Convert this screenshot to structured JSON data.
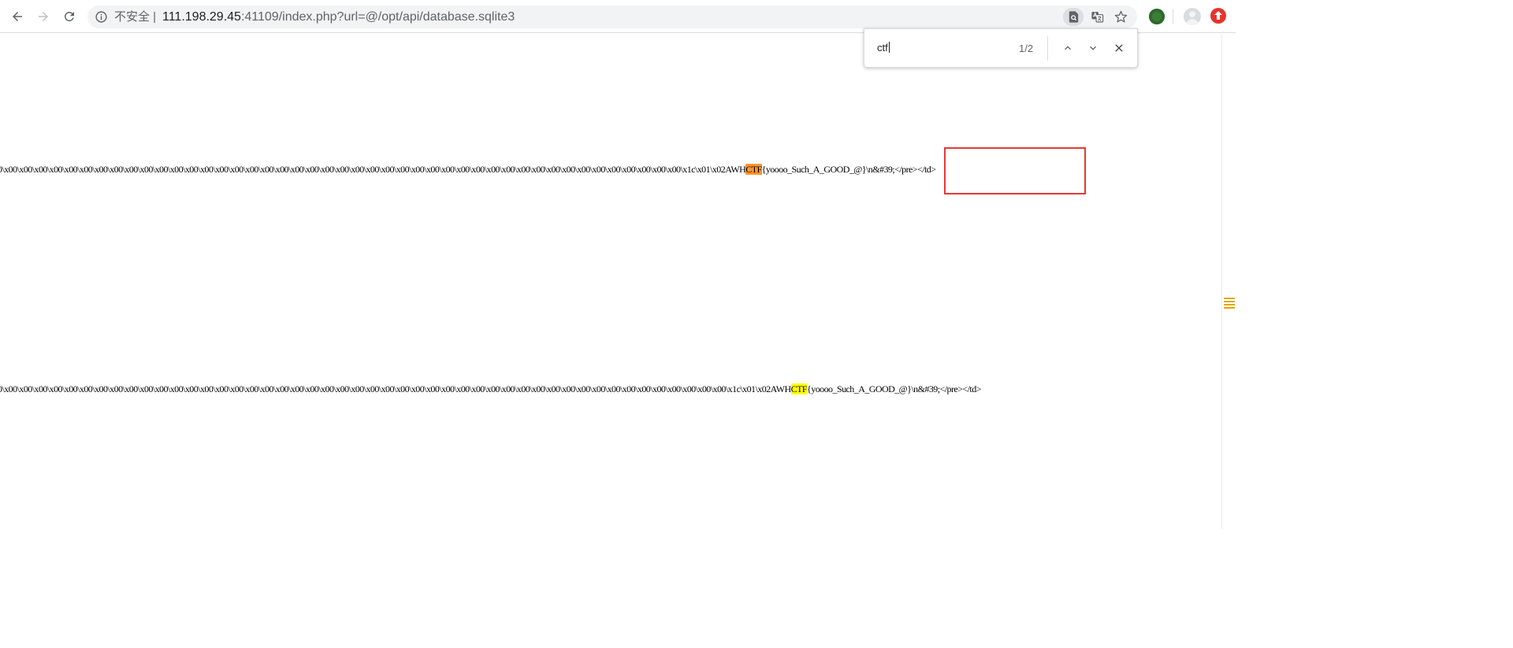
{
  "browser": {
    "security_label": "不安全",
    "url_host": "111.198.29.45",
    "url_rest": ":41109/index.php?url=@/opt/api/database.sqlite3"
  },
  "find_bar": {
    "query": "ctf",
    "match_count": "1/2"
  },
  "content": {
    "lines": [
      {
        "before": "0\\x00\\x00\\x00\\x00\\x00\\x00\\x00\\x00\\x00\\x00\\x00\\x00\\x00\\x00\\x00\\x00\\x00\\x00\\x00\\x00\\x00\\x00\\x00\\x00\\x00\\x00\\x00\\x00\\x00\\x00\\x00\\x00\\x00\\x00\\x00\\x00\\x00\\x00\\x00\\x00\\x00\\x00\\x00\\x00\\x00\\x1c\\x01\\x02AWH",
        "match": "CTF",
        "after": "{yoooo_Such_A_GOOD_@}\\n&#39;</pre></td>",
        "is_current_match": true
      },
      {
        "before": "0\\x00\\x00\\x00\\x00\\x00\\x00\\x00\\x00\\x00\\x00\\x00\\x00\\x00\\x00\\x00\\x00\\x00\\x00\\x00\\x00\\x00\\x00\\x00\\x00\\x00\\x00\\x00\\x00\\x00\\x00\\x00\\x00\\x00\\x00\\x00\\x00\\x00\\x00\\x00\\x00\\x00\\x00\\x00\\x00\\x00\\x00\\x00\\x00\\x1c\\x01\\x02AWH",
        "match": "CTF",
        "after": "{yoooo_Such_A_GOOD_@}\\n&#39;</pre></td>",
        "is_current_match": false
      }
    ]
  },
  "colors": {
    "current_match_highlight": "#ff9632",
    "match_highlight": "#ffff00",
    "annotation_box": "#e53935"
  },
  "icons": {
    "back": "arrow-left-icon",
    "forward": "arrow-right-icon",
    "reload": "reload-icon",
    "info": "info-icon",
    "find_in_page": "find-in-page-icon",
    "translate": "translate-icon",
    "bookmark": "star-icon",
    "extension": "extension-icon",
    "profile": "profile-avatar-icon",
    "update": "update-arrow-icon",
    "find_prev": "chevron-up-icon",
    "find_next": "chevron-down-icon",
    "find_close": "close-icon"
  }
}
